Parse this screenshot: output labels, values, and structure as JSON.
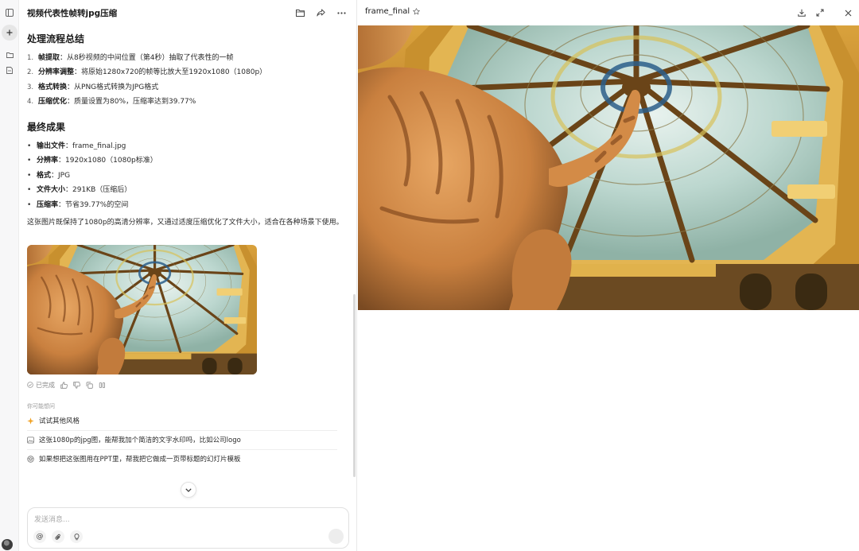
{
  "icons": {
    "sidebar_toggle": "sidebar-toggle-icon",
    "new_chat": "plus-icon",
    "folder": "folder-icon",
    "document": "document-icon",
    "folder_open": "folder-open-icon",
    "share": "share-icon",
    "more": "more-dots-icon",
    "star": "star-outline-icon",
    "download": "download-icon",
    "expand": "expand-icon",
    "close": "close-icon"
  },
  "chat": {
    "title": "视频代表性帧转jpg压缩",
    "section1": {
      "heading": "处理流程总结",
      "items": [
        {
          "num": "1.",
          "key": "帧提取",
          "text": "：从8秒视频的中间位置（第4秒）抽取了代表性的一帧"
        },
        {
          "num": "2.",
          "key": "分辨率调整",
          "text": "：将原始1280x720的帧等比放大至1920x1080（1080p）"
        },
        {
          "num": "3.",
          "key": "格式转换",
          "text": "：从PNG格式转换为JPG格式"
        },
        {
          "num": "4.",
          "key": "压缩优化",
          "text": "：质量设置为80%，压缩率达到39.77%"
        }
      ]
    },
    "section2": {
      "heading": "最终成果",
      "items": [
        {
          "key": "输出文件",
          "text": "：frame_final.jpg"
        },
        {
          "key": "分辨率",
          "text": "：1920x1080（1080p标准）"
        },
        {
          "key": "格式",
          "text": "：JPG"
        },
        {
          "key": "文件大小",
          "text": "：291KB（压缩后）"
        },
        {
          "key": "压缩率",
          "text": "：节省39.77%的空间"
        }
      ]
    },
    "summary": "这张图片既保持了1080p的高清分辨率，又通过适度压缩优化了文件大小，适合在各种场景下使用。",
    "status_done": "已完成",
    "suggestions_label": "你可能想问",
    "suggestions": [
      "试试其他风格",
      "这张1080p的jpg图，能帮我加个简洁的文字水印吗，比如公司logo",
      "如果想把这张图用在PPT里，帮我把它做成一页带标题的幻灯片模板"
    ],
    "composer_placeholder": "发送消息..."
  },
  "preview": {
    "filename": "frame_final"
  },
  "colors": {
    "accent_spark": "#f0a020",
    "border": "#e8e8e8"
  }
}
